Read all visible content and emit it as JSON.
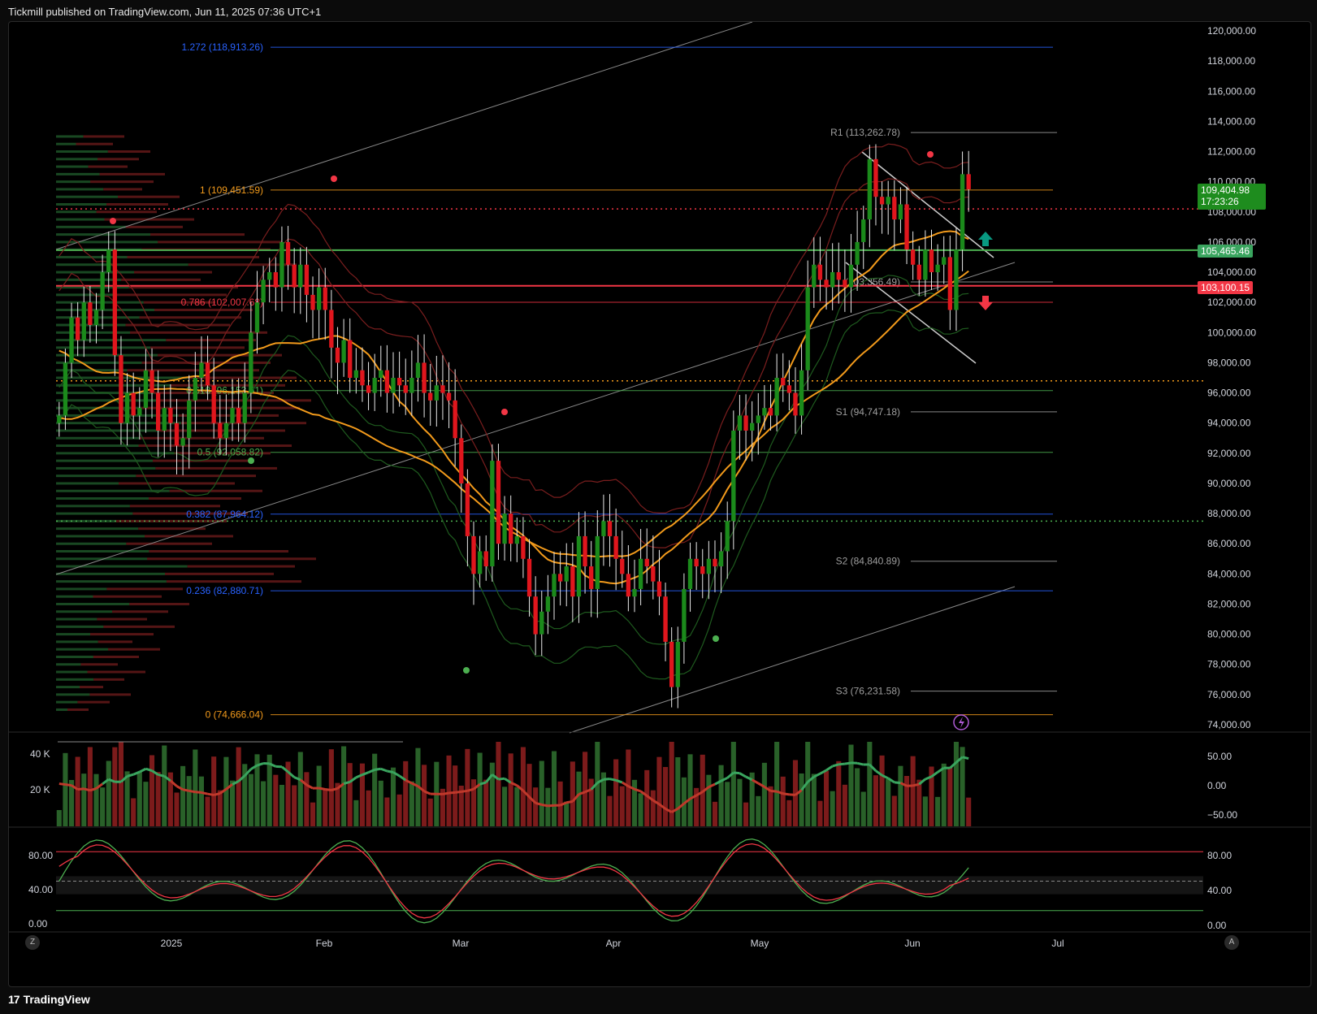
{
  "header": {
    "publish_text": "Tickmill published on TradingView.com, Jun 11, 2025 07:36 UTC+1"
  },
  "footer": {
    "brand": "TradingView",
    "logo_mark": "17"
  },
  "scale_buttons": {
    "left": "Z",
    "right": "A"
  },
  "badges": {
    "last_price": "109,404.98",
    "countdown": "17:23:26",
    "support_level": "105,465.46",
    "resistance_level": "103,100.15"
  },
  "colors": {
    "background": "#000000",
    "up": "#089981",
    "up_candle": "#1b8a1b",
    "down_candle": "#e0161d",
    "ema_orange": "#f29a1b",
    "green_line": "#4caf50",
    "red_line": "#f23645",
    "fib_blue": "#2962ff",
    "badge_green": "#1e8c1e",
    "badge_red": "#f23645",
    "badge_lightgreen": "#3aa55f"
  },
  "chart_data": [
    {
      "type": "candlestick",
      "title": "",
      "x_tick_labels": [
        "2025",
        "Feb",
        "Mar",
        "Apr",
        "May",
        "Jun",
        "Jul"
      ],
      "y_tick_labels": [
        "120,000.00",
        "118,000.00",
        "116,000.00",
        "114,000.00",
        "112,000.00",
        "110,000.00",
        "108,000.00",
        "106,000.00",
        "104,000.00",
        "102,000.00",
        "100,000.00",
        "98,000.00",
        "96,000.00",
        "94,000.00",
        "92,000.00",
        "90,000.00",
        "88,000.00",
        "86,000.00",
        "84,000.00",
        "82,000.00",
        "80,000.00",
        "78,000.00",
        "76,000.00",
        "74,000.00"
      ],
      "ylim": [
        73500,
        120500
      ],
      "grid": false,
      "close_series": {
        "name": "",
        "values": [
          94500,
          98000,
          101000,
          99500,
          102000,
          100500,
          101500,
          104000,
          105500,
          98500,
          94000,
          96000,
          94500,
          95000,
          97500,
          96000,
          93500,
          95000,
          94000,
          92500,
          93000,
          95500,
          97000,
          98000,
          96500,
          94000,
          93000,
          94000,
          95000,
          94000,
          96000,
          100000,
          102000,
          103500,
          104000,
          103000,
          106000,
          104500,
          103000,
          104500,
          102500,
          101500,
          103000,
          101500,
          99000,
          98000,
          99500,
          97000,
          97500,
          96500,
          96000,
          97000,
          97500,
          96000,
          97000,
          96500,
          96000,
          97000,
          98000,
          96000,
          95500,
          96500,
          96000,
          95500,
          93000,
          90000,
          86500,
          84000,
          85500,
          84500,
          91500,
          86000,
          88000,
          86000,
          86500,
          85000,
          82500,
          80000,
          81500,
          82500,
          84000,
          83500,
          84500,
          82500,
          86500,
          84500,
          83000,
          86500,
          87500,
          86500,
          85000,
          84000,
          82500,
          83000,
          85000,
          84500,
          83500,
          82500,
          79500,
          76500,
          79500,
          83000,
          85000,
          84500,
          84000,
          85000,
          84500,
          85500,
          87500,
          93500,
          94500,
          93500,
          94000,
          94500,
          95000,
          94500,
          97000,
          96500,
          96000,
          94500,
          97500,
          103000,
          104500,
          103500,
          103000,
          104000,
          103500,
          103000,
          104500,
          106000,
          107500,
          111500,
          109000,
          108500,
          109000,
          107500,
          108500,
          105500,
          104500,
          103500,
          105500,
          104000,
          104500,
          105000,
          101500,
          105500,
          110500,
          109500
        ]
      },
      "horizontal_levels": [
        {
          "label": "1.272 (118,913.26)",
          "value": 118913.26
        },
        {
          "label": "R1 (113,262.78)",
          "value": 113262.78
        },
        {
          "label": "1 (109,451.59)",
          "value": 109451.59
        },
        {
          "label": "0.786 (102,007.68)",
          "value": 102007.68
        },
        {
          "label": "0.618 (96,153.51)",
          "value": 96153.51
        },
        {
          "label": "S1 (94,747.18)",
          "value": 94747.18
        },
        {
          "label": "0.5 (92,058.82)",
          "value": 92058.82
        },
        {
          "label": "0.382 (87,964.12)",
          "value": 87964.12
        },
        {
          "label": "S2 (84,840.89)",
          "value": 84840.89
        },
        {
          "label": "0.236 (82,880.71)",
          "value": 82880.71
        },
        {
          "label": "S3 (76,231.58)",
          "value": 76231.58
        },
        {
          "label": "0 (74,666.04)",
          "value": 74666.04
        },
        {
          "label": "(103,356.49)",
          "value": 103356.49
        }
      ],
      "marked_levels": [
        {
          "value": 105465.46,
          "kind": "support"
        },
        {
          "value": 103100.15,
          "kind": "resistance"
        },
        {
          "value": 108200,
          "kind": "dotted-red"
        },
        {
          "value": 96800,
          "kind": "dotted-orange"
        },
        {
          "value": 87500,
          "kind": "dotted-green"
        }
      ]
    },
    {
      "type": "bar",
      "title": "",
      "left_tick_labels": [
        "40 K",
        "20 K"
      ],
      "right_tick_labels": [
        "50.00",
        "0.00",
        "−50.00"
      ]
    },
    {
      "type": "line",
      "title": "",
      "left_tick_labels": [
        "80.00",
        "40.00",
        "0.00"
      ],
      "right_tick_labels": [
        "80.00",
        "40.00",
        "0.00"
      ],
      "upper_band": 80,
      "lower_band": 20
    }
  ]
}
